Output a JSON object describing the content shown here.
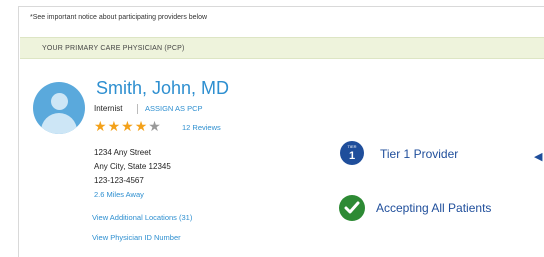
{
  "notice": "*See important notice about participating providers below",
  "pcp_bar": {
    "label": "YOUR PRIMARY CARE PHYSICIAN (PCP)"
  },
  "provider": {
    "name": "Smith, John, MD",
    "specialty": "Internist",
    "assign_link": "ASSIGN AS PCP",
    "rating": 4,
    "rating_max": 5,
    "reviews": "12 Reviews",
    "address_line1": "1234 Any Street",
    "address_line2": "Any City, State 12345",
    "phone": "123-123-4567",
    "distance": "2.6 Miles Away",
    "locations_link": "View Additional Locations (31)",
    "id_link": "View Physician ID Number"
  },
  "badges": {
    "tier_icon_top": "TIER",
    "tier_icon_num": "1",
    "tier_label": "Tier 1 Provider",
    "accepting_label": "Accepting All Patients"
  },
  "colors": {
    "link": "#2e8fd0",
    "tier": "#1f4e9b",
    "check": "#2d8a34",
    "star": "#f3a11a",
    "pcp_bar": "#eef3dc"
  },
  "icons": {
    "avatar": "user-avatar-icon",
    "tier": "tier-badge-icon",
    "check": "check-circle-icon",
    "star": "star-icon",
    "arrow": "chevron-left-icon"
  }
}
